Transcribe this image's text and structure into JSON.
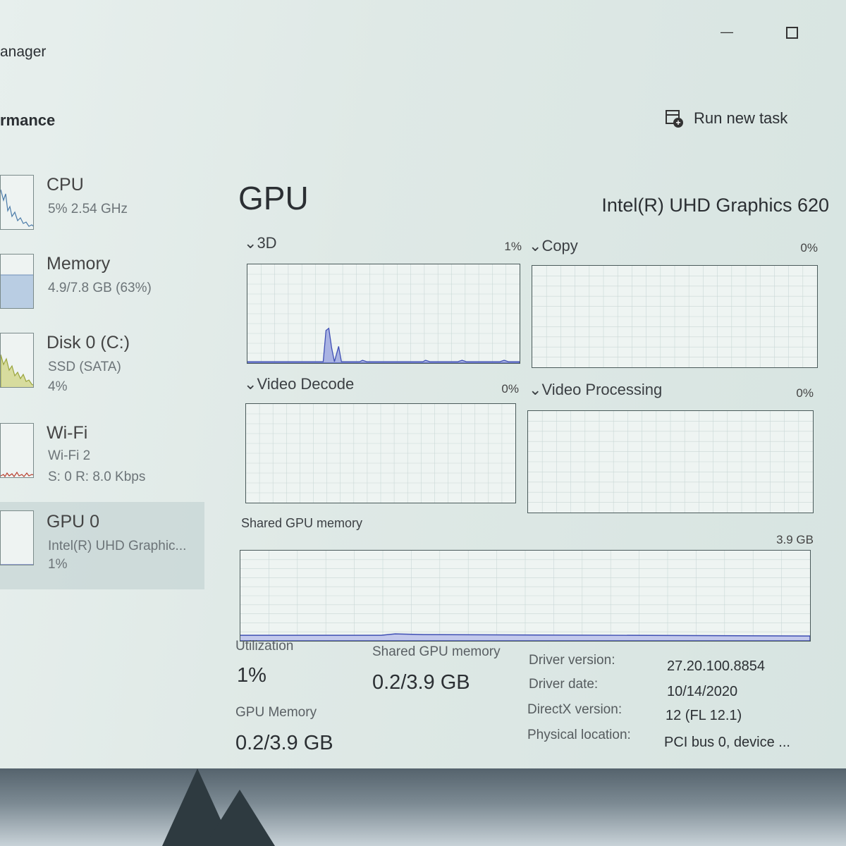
{
  "window": {
    "title": "anager",
    "section": "rmance",
    "run_new_task": "Run new task",
    "minimize_glyph": "—"
  },
  "sidebar": {
    "items": [
      {
        "name": "CPU",
        "line1": "5%  2.54 GHz",
        "line2": ""
      },
      {
        "name": "Memory",
        "line1": "4.9/7.8 GB (63%)",
        "line2": ""
      },
      {
        "name": "Disk 0 (C:)",
        "line1": "SSD (SATA)",
        "line2": "4%"
      },
      {
        "name": "Wi-Fi",
        "line1": "Wi-Fi 2",
        "line2": "S: 0 R: 8.0 Kbps"
      },
      {
        "name": "GPU 0",
        "line1": "Intel(R) UHD Graphic...",
        "line2": "1%"
      }
    ]
  },
  "gpu": {
    "title": "GPU",
    "model": "Intel(R) UHD Graphics 620",
    "engines": [
      {
        "label": "3D",
        "value": "1%"
      },
      {
        "label": "Copy",
        "value": "0%"
      },
      {
        "label": "Video Decode",
        "value": "0%"
      },
      {
        "label": "Video Processing",
        "value": "0%"
      }
    ],
    "shared_memory_graph": {
      "label": "Shared GPU memory",
      "max": "3.9 GB"
    },
    "stats": {
      "utilization_label": "Utilization",
      "utilization_value": "1%",
      "shared_label": "Shared GPU memory",
      "shared_value": "0.2/3.9 GB",
      "gpu_memory_label": "GPU Memory",
      "gpu_memory_value": "0.2/3.9 GB"
    },
    "details": [
      {
        "label": "Driver version:",
        "value": "27.20.100.8854"
      },
      {
        "label": "Driver date:",
        "value": "10/14/2020"
      },
      {
        "label": "DirectX version:",
        "value": "12 (FL 12.1)"
      },
      {
        "label": "Physical location:",
        "value": "PCI bus 0, device ..."
      }
    ]
  },
  "colors": {
    "gpu_line": "#3f4fb4",
    "gpu_fill": "#a9b3e3",
    "memory_fill": "#b9cde3",
    "disk_line": "#9aa43c",
    "wifi_line": "#b84030",
    "cpu_line": "#4a7aa8"
  }
}
